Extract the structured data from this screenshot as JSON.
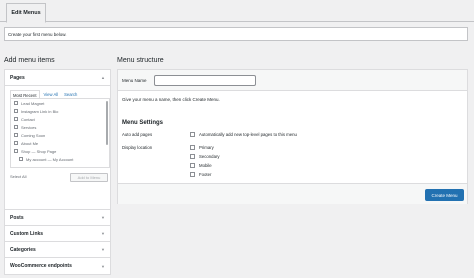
{
  "tabs": {
    "edit_menus": "Edit Menus"
  },
  "notice": "Create your first menu below.",
  "left": {
    "heading": "Add menu items",
    "pages": {
      "title": "Pages",
      "tabs": [
        "Most Recent",
        "View All",
        "Search"
      ],
      "items": [
        {
          "label": "Lead Magnet",
          "indent": false
        },
        {
          "label": "Instagram Link in Bio",
          "indent": false
        },
        {
          "label": "Contact",
          "indent": false
        },
        {
          "label": "Services",
          "indent": false
        },
        {
          "label": "Coming Soon",
          "indent": false
        },
        {
          "label": "About Me",
          "indent": false
        },
        {
          "label": "Shop — Shop Page",
          "indent": false
        },
        {
          "label": "My account — My Account",
          "indent": true
        }
      ],
      "select_all": "Select All",
      "add_button": "Add to Menu"
    },
    "sections": [
      "Posts",
      "Custom Links",
      "Categories",
      "WooCommerce endpoints"
    ]
  },
  "right": {
    "heading": "Menu structure",
    "menu_name_label": "Menu Name",
    "menu_name_value": "",
    "hint": "Give your menu a name, then click Create Menu.",
    "settings_heading": "Menu Settings",
    "auto_add_label": "Auto add pages",
    "auto_add_option": "Automatically add new top-level pages to this menu",
    "display_location_label": "Display location",
    "locations": [
      "Primary",
      "Secondary",
      "Mobile",
      "Footer"
    ],
    "create_button": "Create Menu"
  }
}
